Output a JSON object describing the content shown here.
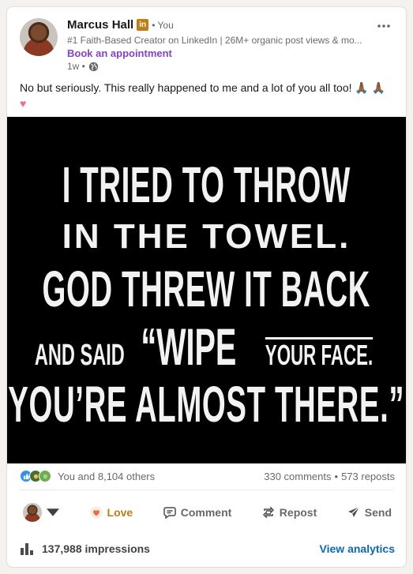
{
  "post": {
    "author": {
      "name": "Marcus Hall",
      "badge": "in",
      "relation": "• You",
      "headline": "#1 Faith-Based Creator on LinkedIn | 26M+ organic post views & mo...",
      "cta": "Book an appointment",
      "time": "1w •"
    },
    "text": "No but seriously. This really happened to me and a lot of you all too! ",
    "emoji_pray": "🙏🏾 🙏🏾",
    "emoji_heart": "♥",
    "image_quote": {
      "line1": "I TRIED TO THROW",
      "line2": "IN THE TOWEL.",
      "line3": "GOD THREW IT BACK",
      "line4a": "AND SAID",
      "line4b": "“WIPE",
      "line4c": "YOUR FACE.",
      "line5": "YOU’RE ALMOST THERE.”"
    },
    "social": {
      "reactions_text": "You and 8,104 others",
      "comments": "330 comments",
      "separator": "•",
      "reposts": "573 reposts"
    },
    "actions": {
      "love": "Love",
      "comment": "Comment",
      "repost": "Repost",
      "send": "Send"
    },
    "footer": {
      "impressions": "137,988 impressions",
      "analytics": "View analytics"
    }
  },
  "colors": {
    "brand_blue": "#0a66c2",
    "love_orange": "#c37d16",
    "cta_purple": "#8344cc"
  }
}
